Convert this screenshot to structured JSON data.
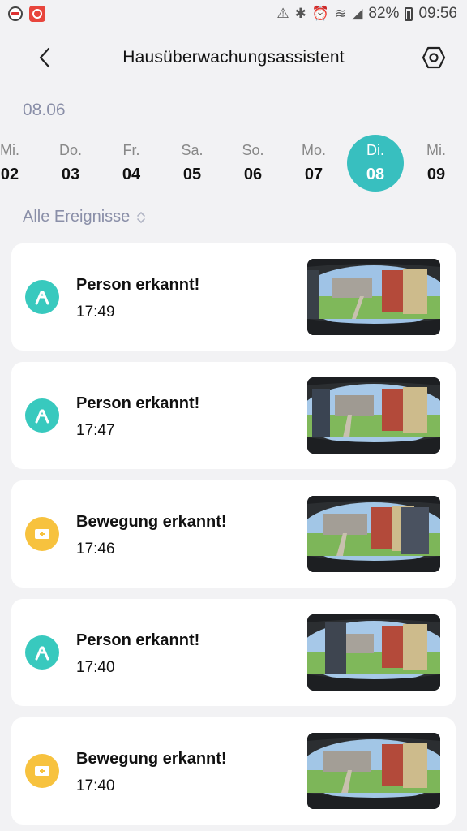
{
  "status": {
    "battery": "82%",
    "time": "09:56"
  },
  "header": {
    "title": "Hausüberwachungsassistent"
  },
  "selected_date": "08.06",
  "week": [
    {
      "name": "Mi.",
      "num": "02"
    },
    {
      "name": "Do.",
      "num": "03"
    },
    {
      "name": "Fr.",
      "num": "04"
    },
    {
      "name": "Sa.",
      "num": "05"
    },
    {
      "name": "So.",
      "num": "06"
    },
    {
      "name": "Mo.",
      "num": "07"
    },
    {
      "name": "Di.",
      "num": "08",
      "active": true
    },
    {
      "name": "Mi.",
      "num": "09"
    }
  ],
  "filter": {
    "label": "Alle Ereignisse"
  },
  "events": [
    {
      "title": "Person erkannt!",
      "time": "17:49",
      "type": "person",
      "color": "#38c9be",
      "icon": "person-walk-icon"
    },
    {
      "title": "Person erkannt!",
      "time": "17:47",
      "type": "person",
      "color": "#38c9be",
      "icon": "person-walk-icon"
    },
    {
      "title": "Bewegung erkannt!",
      "time": "17:46",
      "type": "motion",
      "color": "#f7c23e",
      "icon": "motion-icon"
    },
    {
      "title": "Person erkannt!",
      "time": "17:40",
      "type": "person",
      "color": "#38c9be",
      "icon": "person-walk-icon"
    },
    {
      "title": "Bewegung erkannt!",
      "time": "17:40",
      "type": "motion",
      "color": "#f7c23e",
      "icon": "motion-icon"
    }
  ],
  "colors": {
    "accent": "#38bfbf",
    "person": "#38c9be",
    "motion": "#f7c23e"
  }
}
